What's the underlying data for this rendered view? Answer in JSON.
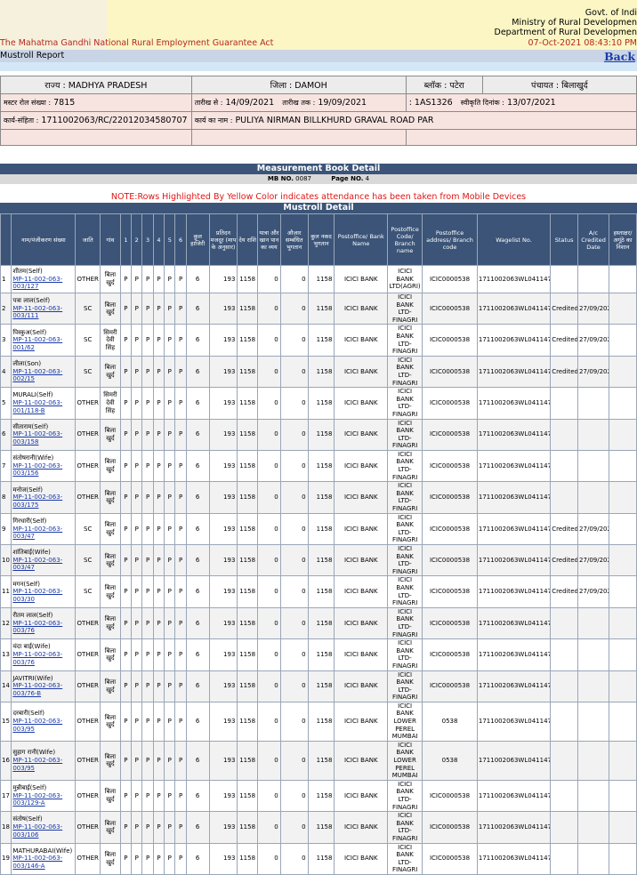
{
  "header": {
    "gov_line1": "Govt. of Indi",
    "gov_line2": "Ministry of Rural Developmen",
    "gov_line3": "Department of Rural Developmen",
    "act_title": "The Mahatma Gandhi National Rural Employment Guarantee Act",
    "datetime": "07-Oct-2021 08:43:10 PM"
  },
  "report_title": "Mustroll Report",
  "back_link": "Back",
  "info": {
    "state_label": "राज्य :",
    "state": "MADHYA PRADESH",
    "district_label": "जिला :",
    "district": "DAMOH",
    "block_label": "ब्लॉक :",
    "block": "पटेरा",
    "panchayat_label": "पंचायत :",
    "panchayat": "बिलाखुर्द",
    "musterroll_no_label": "मस्टर रोल संख्या :",
    "musterroll_no": "7815",
    "date_from_label": "तारीख से :",
    "date_from": "14/09/2021",
    "date_to_label": "तारीख तक :",
    "date_to": "19/09/2021",
    "code_prefix": ":",
    "code": "1AS1326",
    "sanction_label": "स्वीकृति दिनांक :",
    "sanction_date": "13/07/2021",
    "work_code_label": "कार्य-संहिता :",
    "work_code": "1711002063/RC/22012034580707",
    "work_name_label": "कार्य का नाम :",
    "work_name": "PULIYA NIRMAN BILLKHURD GRAVAL ROAD PAR"
  },
  "mb_section": {
    "title": "Measurement Book Detail",
    "mb_no_label": "MB NO.",
    "mb_no": "0087",
    "page_no_label": "Page NO.",
    "page_no": "4"
  },
  "note": "NOTE:Rows Highlighted By Yellow Color indicates attendance has been taken from Mobile Devices",
  "mustroll_title": "Mustroll Detail",
  "columns": [
    "",
    "नाम/पंजीकरण संख्या",
    "जाति",
    "गांव",
    "1",
    "2",
    "3",
    "4",
    "5",
    "6",
    "कुल हाजिरी",
    "प्रतिदन मजदूर (माप के अनुसार)",
    "देय राशि",
    "यात्रा और खान पान का व्यय",
    "औज़ार सम्बंधित भुगतान",
    "कुल नकद भुगतान",
    "Postoffice/ Bank Name",
    "Postoffice Code/ Branch name",
    "Postoffice address/ Branch code",
    "Wagelist No.",
    "Status",
    "A/c Credited Date",
    "हस्ताक्षर/ अगूंठे का निशान"
  ],
  "rows": [
    {
      "sn": "1",
      "name": "शीतम(Self)",
      "reg": "MP-11-002-063-003/127",
      "caste": "OTHER",
      "village": "बिला खुर्द",
      "att": [
        "P",
        "P",
        "P",
        "P",
        "P",
        "P"
      ],
      "total": "6",
      "daily": "193",
      "due": "1158",
      "travel": "0",
      "tools": "0",
      "cash": "1158",
      "bank": "ICICI BANK",
      "branch": "ICICI BANK LTD(AGRI)",
      "code": "ICIC0000538",
      "wagelist": "1711002063WL041147",
      "status": "",
      "date": ""
    },
    {
      "sn": "2",
      "name": "पत्रा लाल(Self)",
      "reg": "MP-11-002-063-003/111",
      "caste": "SC",
      "village": "बिला खुर्द",
      "att": [
        "P",
        "P",
        "P",
        "P",
        "P",
        "P"
      ],
      "total": "6",
      "daily": "193",
      "due": "1158",
      "travel": "0",
      "tools": "0",
      "cash": "1158",
      "bank": "ICICI BANK",
      "branch": "ICICI BANK LTD-FINAGRI",
      "code": "ICIC0000538",
      "wagelist": "1711002063WL041147",
      "status": "Credited",
      "date": "27/09/2021"
    },
    {
      "sn": "3",
      "name": "पिस्कुअ(Self)",
      "reg": "MP-11-002-063-001/62",
      "caste": "SC",
      "village": "सिमरी देवी सिंह",
      "att": [
        "P",
        "P",
        "P",
        "P",
        "P",
        "P"
      ],
      "total": "6",
      "daily": "193",
      "due": "1158",
      "travel": "0",
      "tools": "0",
      "cash": "1158",
      "bank": "ICICI BANK",
      "branch": "ICICI BANK LTD-FINAGRI",
      "code": "ICIC0000538",
      "wagelist": "1711002063WL041147",
      "status": "Credited",
      "date": "27/09/2021"
    },
    {
      "sn": "4",
      "name": "लीला(Son)",
      "reg": "MP-11-002-063-002/15",
      "caste": "SC",
      "village": "बिला खुर्द",
      "att": [
        "P",
        "P",
        "P",
        "P",
        "P",
        "P"
      ],
      "total": "6",
      "daily": "193",
      "due": "1158",
      "travel": "0",
      "tools": "0",
      "cash": "1158",
      "bank": "ICICI BANK",
      "branch": "ICICI BANK LTD-FINAGRI",
      "code": "ICIC0000538",
      "wagelist": "1711002063WL041147",
      "status": "Credited",
      "date": "27/09/2021"
    },
    {
      "sn": "5",
      "name": "MURALI(Self)",
      "reg": "MP-11-002-063-001/118-B",
      "caste": "OTHER",
      "village": "सिमरी देवी सिंह",
      "att": [
        "P",
        "P",
        "P",
        "P",
        "P",
        "P"
      ],
      "total": "6",
      "daily": "193",
      "due": "1158",
      "travel": "0",
      "tools": "0",
      "cash": "1158",
      "bank": "ICICI BANK",
      "branch": "ICICI BANK LTD-FINAGRI",
      "code": "ICIC0000538",
      "wagelist": "1711002063WL041147",
      "status": "",
      "date": ""
    },
    {
      "sn": "6",
      "name": "सीताराम(Self)",
      "reg": "MP-11-002-063-003/158",
      "caste": "OTHER",
      "village": "बिला खुर्द",
      "att": [
        "P",
        "P",
        "P",
        "P",
        "P",
        "P"
      ],
      "total": "6",
      "daily": "193",
      "due": "1158",
      "travel": "0",
      "tools": "0",
      "cash": "1158",
      "bank": "ICICI BANK",
      "branch": "ICICI BANK LTD-FINAGRI",
      "code": "ICIC0000538",
      "wagelist": "1711002063WL041147",
      "status": "",
      "date": ""
    },
    {
      "sn": "7",
      "name": "संतोषरानी(Wife)",
      "reg": "MP-11-002-063-003/156",
      "caste": "OTHER",
      "village": "बिला खुर्द",
      "att": [
        "P",
        "P",
        "P",
        "P",
        "P",
        "P"
      ],
      "total": "6",
      "daily": "193",
      "due": "1158",
      "travel": "0",
      "tools": "0",
      "cash": "1158",
      "bank": "ICICI BANK",
      "branch": "ICICI BANK LTD-FINAGRI",
      "code": "ICIC0000538",
      "wagelist": "1711002063WL041147",
      "status": "",
      "date": ""
    },
    {
      "sn": "8",
      "name": "मनोज(Self)",
      "reg": "MP-11-002-063-003/175",
      "caste": "OTHER",
      "village": "बिला खुर्द",
      "att": [
        "P",
        "P",
        "P",
        "P",
        "P",
        "P"
      ],
      "total": "6",
      "daily": "193",
      "due": "1158",
      "travel": "0",
      "tools": "0",
      "cash": "1158",
      "bank": "ICICI BANK",
      "branch": "ICICI BANK LTD-FINAGRI",
      "code": "ICIC0000538",
      "wagelist": "1711002063WL041147",
      "status": "",
      "date": ""
    },
    {
      "sn": "9",
      "name": "गिरधारी(Self)",
      "reg": "MP-11-002-063-003/47",
      "caste": "SC",
      "village": "बिला खुर्द",
      "att": [
        "P",
        "P",
        "P",
        "P",
        "P",
        "P"
      ],
      "total": "6",
      "daily": "193",
      "due": "1158",
      "travel": "0",
      "tools": "0",
      "cash": "1158",
      "bank": "ICICI BANK",
      "branch": "ICICI BANK LTD-FINAGRI",
      "code": "ICIC0000538",
      "wagelist": "1711002063WL041147",
      "status": "Credited",
      "date": "27/09/2021"
    },
    {
      "sn": "10",
      "name": "शांतिबाई(Wife)",
      "reg": "MP-11-002-063-003/47",
      "caste": "SC",
      "village": "बिला खुर्द",
      "att": [
        "P",
        "P",
        "P",
        "P",
        "P",
        "P"
      ],
      "total": "6",
      "daily": "193",
      "due": "1158",
      "travel": "0",
      "tools": "0",
      "cash": "1158",
      "bank": "ICICI BANK",
      "branch": "ICICI BANK LTD-FINAGRI",
      "code": "ICIC0000538",
      "wagelist": "1711002063WL041147",
      "status": "Credited",
      "date": "27/09/2021"
    },
    {
      "sn": "11",
      "name": "मगन(Self)",
      "reg": "MP-11-002-063-003/30",
      "caste": "SC",
      "village": "बिला खुर्द",
      "att": [
        "P",
        "P",
        "P",
        "P",
        "P",
        "P"
      ],
      "total": "6",
      "daily": "193",
      "due": "1158",
      "travel": "0",
      "tools": "0",
      "cash": "1158",
      "bank": "ICICI BANK",
      "branch": "ICICI BANK LTD-FINAGRI",
      "code": "ICIC0000538",
      "wagelist": "1711002063WL041147",
      "status": "Credited",
      "date": "27/09/2021"
    },
    {
      "sn": "12",
      "name": "रीतम लाल(Self)",
      "reg": "MP-11-002-063-003/76",
      "caste": "OTHER",
      "village": "बिला खुर्द",
      "att": [
        "P",
        "P",
        "P",
        "P",
        "P",
        "P"
      ],
      "total": "6",
      "daily": "193",
      "due": "1158",
      "travel": "0",
      "tools": "0",
      "cash": "1158",
      "bank": "ICICI BANK",
      "branch": "ICICI BANK LTD-FINAGRI",
      "code": "ICIC0000538",
      "wagelist": "1711002063WL041147",
      "status": "",
      "date": ""
    },
    {
      "sn": "13",
      "name": "चंदा बाई(Wife)",
      "reg": "MP-11-002-063-003/76",
      "caste": "OTHER",
      "village": "बिला खुर्द",
      "att": [
        "P",
        "P",
        "P",
        "P",
        "P",
        "P"
      ],
      "total": "6",
      "daily": "193",
      "due": "1158",
      "travel": "0",
      "tools": "0",
      "cash": "1158",
      "bank": "ICICI BANK",
      "branch": "ICICI BANK LTD-FINAGRI",
      "code": "ICIC0000538",
      "wagelist": "1711002063WL041147",
      "status": "",
      "date": ""
    },
    {
      "sn": "14",
      "name": "JAVITRI(Wife)",
      "reg": "MP-11-002-063-003/76-B",
      "caste": "OTHER",
      "village": "बिला खुर्द",
      "att": [
        "P",
        "P",
        "P",
        "P",
        "P",
        "P"
      ],
      "total": "6",
      "daily": "193",
      "due": "1158",
      "travel": "0",
      "tools": "0",
      "cash": "1158",
      "bank": "ICICI BANK",
      "branch": "ICICI BANK LTD-FINAGRI",
      "code": "ICIC0000538",
      "wagelist": "1711002063WL041147",
      "status": "",
      "date": ""
    },
    {
      "sn": "15",
      "name": "दरबारी(Self)",
      "reg": "MP-11-002-063-003/95",
      "caste": "OTHER",
      "village": "बिला खुर्द",
      "att": [
        "P",
        "P",
        "P",
        "P",
        "P",
        "P"
      ],
      "total": "6",
      "daily": "193",
      "due": "1158",
      "travel": "0",
      "tools": "0",
      "cash": "1158",
      "bank": "ICICI BANK",
      "branch": "ICICI BANK LOWER PEREL MUMBAI",
      "code": "0538",
      "wagelist": "1711002063WL041147",
      "status": "",
      "date": ""
    },
    {
      "sn": "16",
      "name": "सुहाग रानी(Wife)",
      "reg": "MP-11-002-063-003/95",
      "caste": "OTHER",
      "village": "बिला खुर्द",
      "att": [
        "P",
        "P",
        "P",
        "P",
        "P",
        "P"
      ],
      "total": "6",
      "daily": "193",
      "due": "1158",
      "travel": "0",
      "tools": "0",
      "cash": "1158",
      "bank": "ICICI BANK",
      "branch": "ICICI BANK LOWER PEREL MUMBAI",
      "code": "0538",
      "wagelist": "1711002063WL041147",
      "status": "",
      "date": ""
    },
    {
      "sn": "17",
      "name": "मुन्नीबाई(Self)",
      "reg": "MP-11-002-063-003/129-A",
      "caste": "OTHER",
      "village": "बिला खुर्द",
      "att": [
        "P",
        "P",
        "P",
        "P",
        "P",
        "P"
      ],
      "total": "6",
      "daily": "193",
      "due": "1158",
      "travel": "0",
      "tools": "0",
      "cash": "1158",
      "bank": "ICICI BANK",
      "branch": "ICICI BANK LTD-FINAGRI",
      "code": "ICIC0000538",
      "wagelist": "1711002063WL041147",
      "status": "",
      "date": ""
    },
    {
      "sn": "18",
      "name": "संतोष(Self)",
      "reg": "MP-11-002-063-003/106",
      "caste": "OTHER",
      "village": "बिला खुर्द",
      "att": [
        "P",
        "P",
        "P",
        "P",
        "P",
        "P"
      ],
      "total": "6",
      "daily": "193",
      "due": "1158",
      "travel": "0",
      "tools": "0",
      "cash": "1158",
      "bank": "ICICI BANK",
      "branch": "ICICI BANK LTD-FINAGRI",
      "code": "ICIC0000538",
      "wagelist": "1711002063WL041147",
      "status": "",
      "date": ""
    },
    {
      "sn": "19",
      "name": "MATHURABAI(Wife)",
      "reg": "MP-11-002-063-003/146-A",
      "caste": "OTHER",
      "village": "बिला खुर्द",
      "att": [
        "P",
        "P",
        "P",
        "P",
        "P",
        "P"
      ],
      "total": "6",
      "daily": "193",
      "due": "1158",
      "travel": "0",
      "tools": "0",
      "cash": "1158",
      "bank": "ICICI BANK",
      "branch": "ICICI BANK LTD-FINAGRI",
      "code": "ICIC0000538",
      "wagelist": "1711002063WL041147",
      "status": "",
      "date": ""
    }
  ]
}
